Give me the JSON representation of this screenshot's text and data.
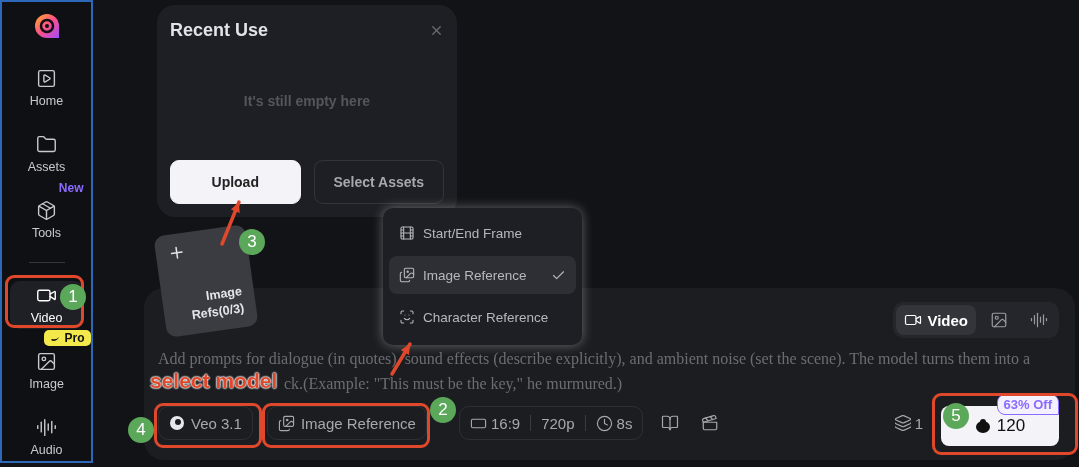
{
  "sidebar": {
    "items": [
      {
        "label": "Home",
        "selected": false
      },
      {
        "label": "Assets",
        "selected": false
      },
      {
        "label": "Tools",
        "selected": false,
        "badge": {
          "text": "New",
          "kind": "text"
        }
      },
      {
        "label": "Video",
        "selected": true,
        "divider_before": true
      },
      {
        "label": "Image",
        "selected": false,
        "badge": {
          "text": "Pro",
          "kind": "pill"
        }
      },
      {
        "label": "Audio",
        "selected": false
      }
    ]
  },
  "recent_use": {
    "title": "Recent Use",
    "empty_text": "It's still empty here",
    "buttons": [
      {
        "label": "Upload",
        "kind": "primary"
      },
      {
        "label": "Select Assets",
        "kind": "secondary"
      }
    ]
  },
  "image_refs_card": {
    "label": "Image Refs(0/3)"
  },
  "mode_menu": {
    "items": [
      {
        "label": "Start/End Frame",
        "selected": false
      },
      {
        "label": "Image Reference",
        "selected": true
      },
      {
        "label": "Character Reference",
        "selected": false
      }
    ]
  },
  "prompt": {
    "media_tabs": [
      {
        "kind": "video",
        "label": "Video",
        "selected": true
      },
      {
        "kind": "image",
        "selected": false
      },
      {
        "kind": "audio",
        "selected": false
      }
    ],
    "placeholder_lines": [
      "Add prompts for dialogue (in quotes), sound effects (describe explicitly), and ambient noise (set the scene). The model turns them into a",
      "ck.(Example: \"This must be the key,\" he murmured.)"
    ],
    "toolbar": {
      "model": "Veo 3.1",
      "mode": "Image Reference",
      "aspect": "16:9",
      "resolution": "720p",
      "duration": "8s",
      "count": "1",
      "credits": "120",
      "discount": "63% Off"
    }
  },
  "annotations": {
    "caption": "select model",
    "steps": [
      "1",
      "2",
      "3",
      "4",
      "5"
    ]
  }
}
